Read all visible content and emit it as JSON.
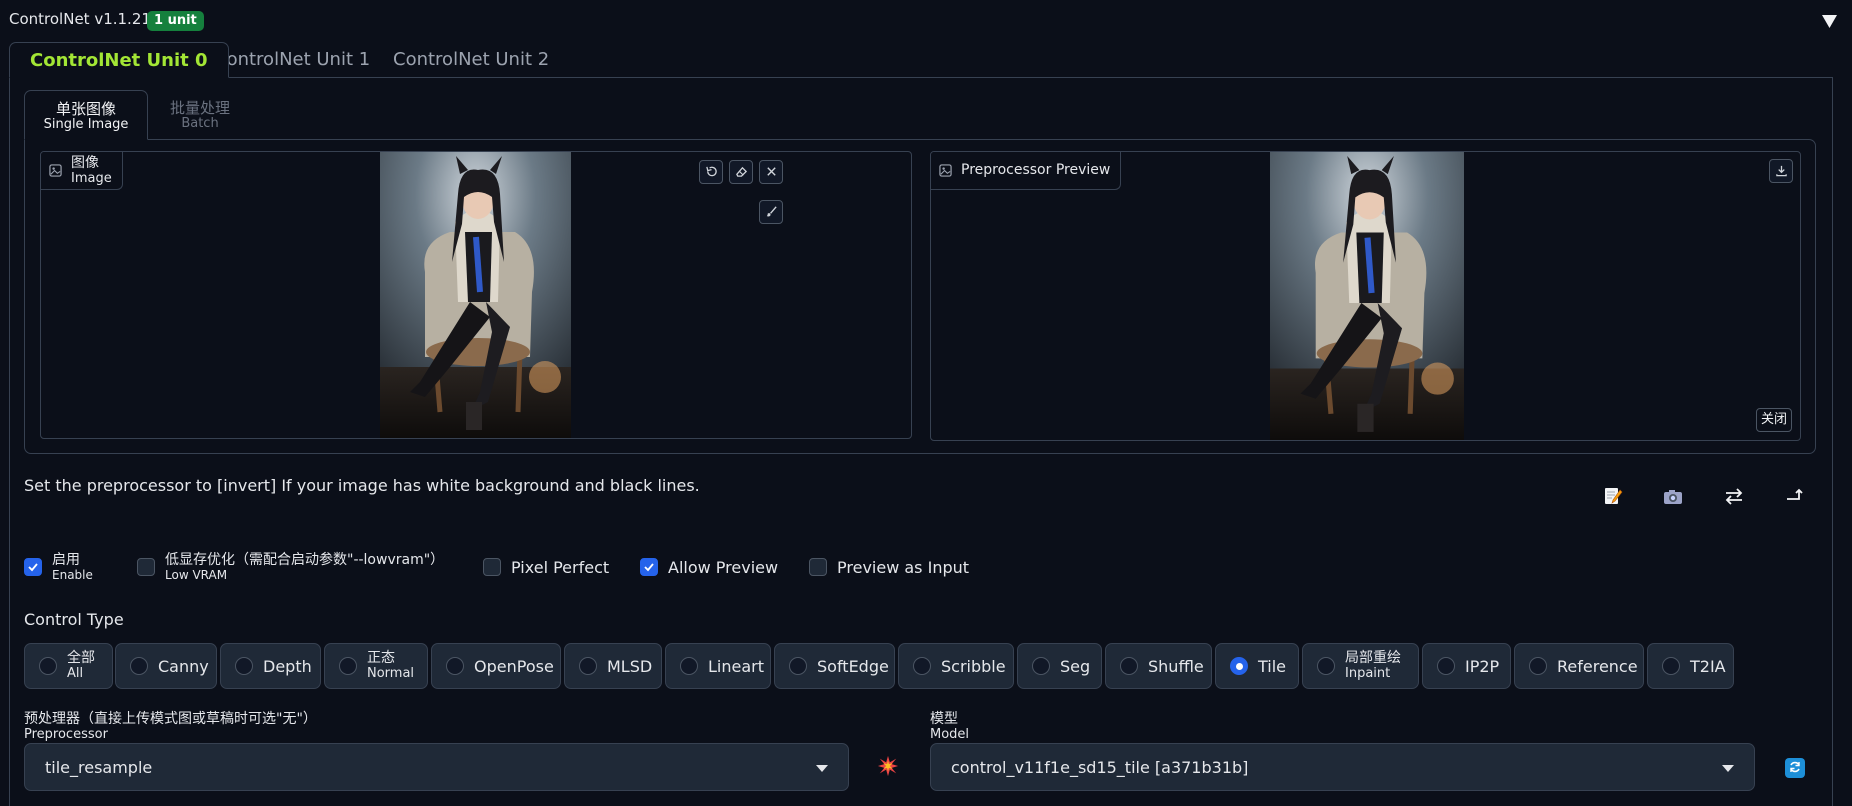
{
  "header": {
    "title": "ControlNet v1.1.219",
    "badge": "1 unit",
    "collapse_icon": "triangle-down-icon"
  },
  "unit_tabs": [
    {
      "label": "ControlNet Unit 0",
      "active": true
    },
    {
      "label": "ControlNet Unit 1",
      "active": false
    },
    {
      "label": "ControlNet Unit 2",
      "active": false
    }
  ],
  "image_tabs": [
    {
      "cn": "单张图像",
      "en": "Single Image",
      "active": true
    },
    {
      "cn": "批量处理",
      "en": "Batch",
      "active": false
    }
  ],
  "source_image": {
    "label_cn": "图像",
    "label_en": "Image",
    "tools": [
      "undo-icon",
      "eraser-icon",
      "close-icon",
      "brush-icon"
    ]
  },
  "preview_image": {
    "label": "Preprocessor Preview",
    "close_label": "关闭",
    "tools": [
      "download-icon"
    ]
  },
  "hint": "Set the preprocessor to [invert] If your image has white background and black lines.",
  "actions": [
    "edit-icon",
    "camera-icon",
    "swap-icon",
    "send-dimensions-icon"
  ],
  "options": [
    {
      "cn": "启用",
      "en": "Enable",
      "checked": true
    },
    {
      "cn": "低显存优化（需配合启动参数\"--lowvram\"）",
      "en": "Low VRAM",
      "checked": false
    },
    {
      "label": "Pixel Perfect",
      "checked": false
    },
    {
      "label": "Allow Preview",
      "checked": true
    },
    {
      "label": "Preview as Input",
      "checked": false
    }
  ],
  "control_type": {
    "label": "Control Type",
    "options": [
      {
        "cn": "全部",
        "en": "All",
        "selected": false
      },
      {
        "label": "Canny",
        "selected": false
      },
      {
        "label": "Depth",
        "selected": false
      },
      {
        "cn": "正态",
        "en": "Normal",
        "selected": false
      },
      {
        "label": "OpenPose",
        "selected": false
      },
      {
        "label": "MLSD",
        "selected": false
      },
      {
        "label": "Lineart",
        "selected": false
      },
      {
        "label": "SoftEdge",
        "selected": false
      },
      {
        "label": "Scribble",
        "selected": false
      },
      {
        "label": "Seg",
        "selected": false
      },
      {
        "label": "Shuffle",
        "selected": false
      },
      {
        "label": "Tile",
        "selected": true
      },
      {
        "cn": "局部重绘",
        "en": "Inpaint",
        "selected": false
      },
      {
        "label": "IP2P",
        "selected": false
      },
      {
        "label": "Reference",
        "selected": false
      },
      {
        "label": "T2IA",
        "selected": false
      }
    ]
  },
  "preprocessor": {
    "label_cn": "预处理器（直接上传模式图或草稿时可选\"无\"）",
    "label_en": "Preprocessor",
    "value": "tile_resample"
  },
  "model": {
    "label_cn": "模型",
    "label_en": "Model",
    "value": "control_v11f1e_sd15_tile [a371b31b]"
  },
  "colors": {
    "background": "#0b0f19",
    "border": "#374151",
    "accent_green": "#a3e635",
    "badge_green": "#15803d",
    "checkbox_blue": "#2563eb"
  }
}
